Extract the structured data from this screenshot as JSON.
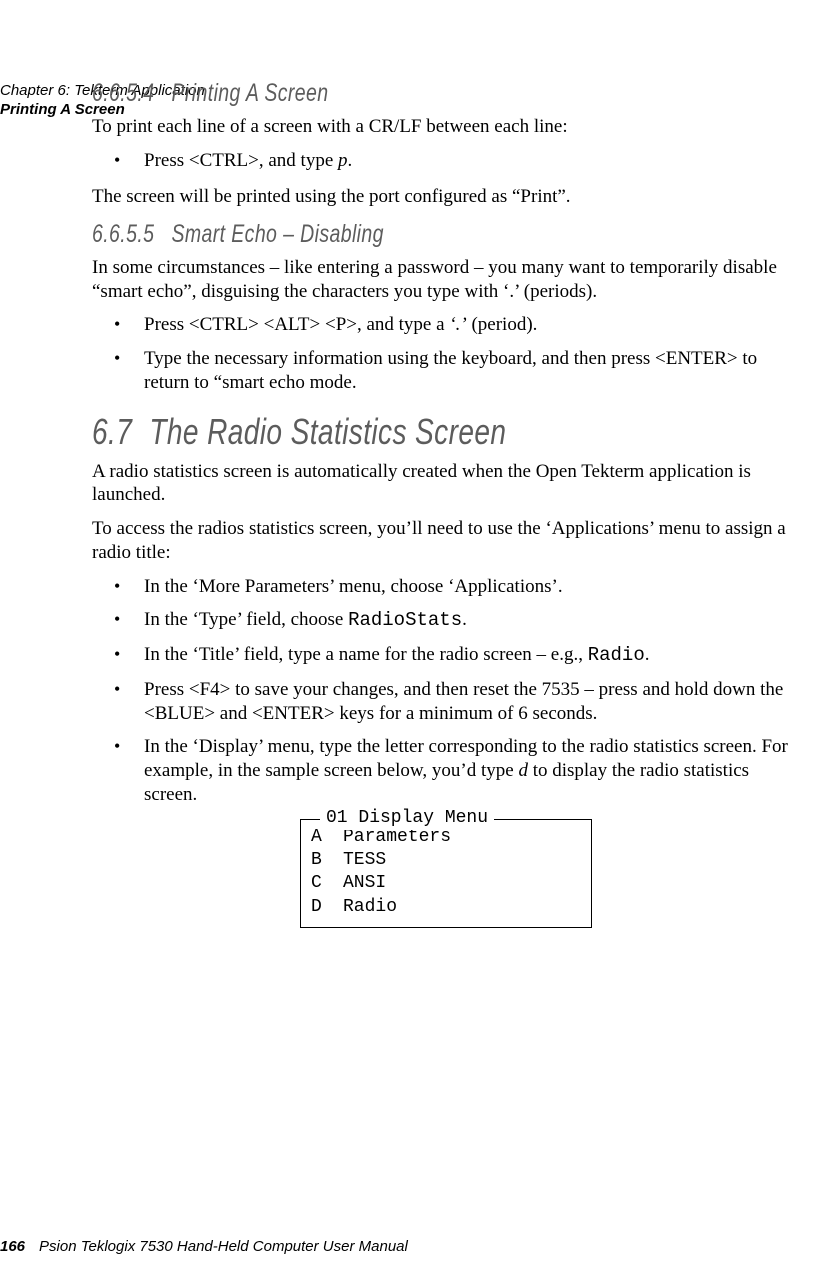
{
  "runningHead": {
    "chapter": "Chapter 6: Tekterm Application",
    "section": "Printing A Screen"
  },
  "sec_6_6_5_4": {
    "num": "6.6.5.4",
    "title": "Printing A Screen",
    "p1": "To print each line of a screen with a CR/LF between each line:",
    "b1a": "Press <CTRL>, and type ",
    "b1b": "p",
    "b1c": ".",
    "p2": "The screen will be printed using the port configured as “Print”."
  },
  "sec_6_6_5_5": {
    "num": "6.6.5.5",
    "title": "Smart Echo – Disabling",
    "p1": "In some circumstances – like entering a password – you many want to temporarily disable “smart echo”, disguising the characters you type with ‘.’ (periods).",
    "b1a": "Press <CTRL> <ALT> <P>, and type a ",
    "b1b": "‘.’",
    "b1c": " (period).",
    "b2": "Type the necessary information using the keyboard, and then press <ENTER> to return to “smart echo mode."
  },
  "sec_6_7": {
    "num": "6.7",
    "title": "The Radio Statistics Screen",
    "p1": "A radio statistics screen is automatically created when the Open Tekterm application is launched.",
    "p2": "To access the radios statistics screen, you’ll need to use the ‘Applications’ menu to assign a radio title:",
    "b1": "In the ‘More Parameters’ menu, choose ‘Applications’.",
    "b2a": "In the ‘Type’ field, choose ",
    "b2b": "RadioStats",
    "b2c": ".",
    "b3a": "In the ‘Title’ field, type a name for the radio screen – e.g., ",
    "b3b": "Radio",
    "b3c": ".",
    "b4": "Press <F4> to save your changes, and then reset the 7535 – press and hold down the <BLUE> and <ENTER> keys for a minimum of 6 seconds.",
    "b5a": "In the ‘Display’ menu, type the letter corresponding to the radio statistics screen. For example, in the sample screen below, you’d type ",
    "b5b": "d",
    "b5c": " to display the radio statistics screen."
  },
  "menu": {
    "title": "01 Display Menu",
    "rows": [
      {
        "k": "A",
        "v": "Parameters"
      },
      {
        "k": "B",
        "v": "TESS"
      },
      {
        "k": "C",
        "v": "ANSI"
      },
      {
        "k": "D",
        "v": "Radio"
      }
    ]
  },
  "footer": {
    "page": "166",
    "text": "Psion Teklogix 7530 Hand-Held Computer User Manual"
  }
}
